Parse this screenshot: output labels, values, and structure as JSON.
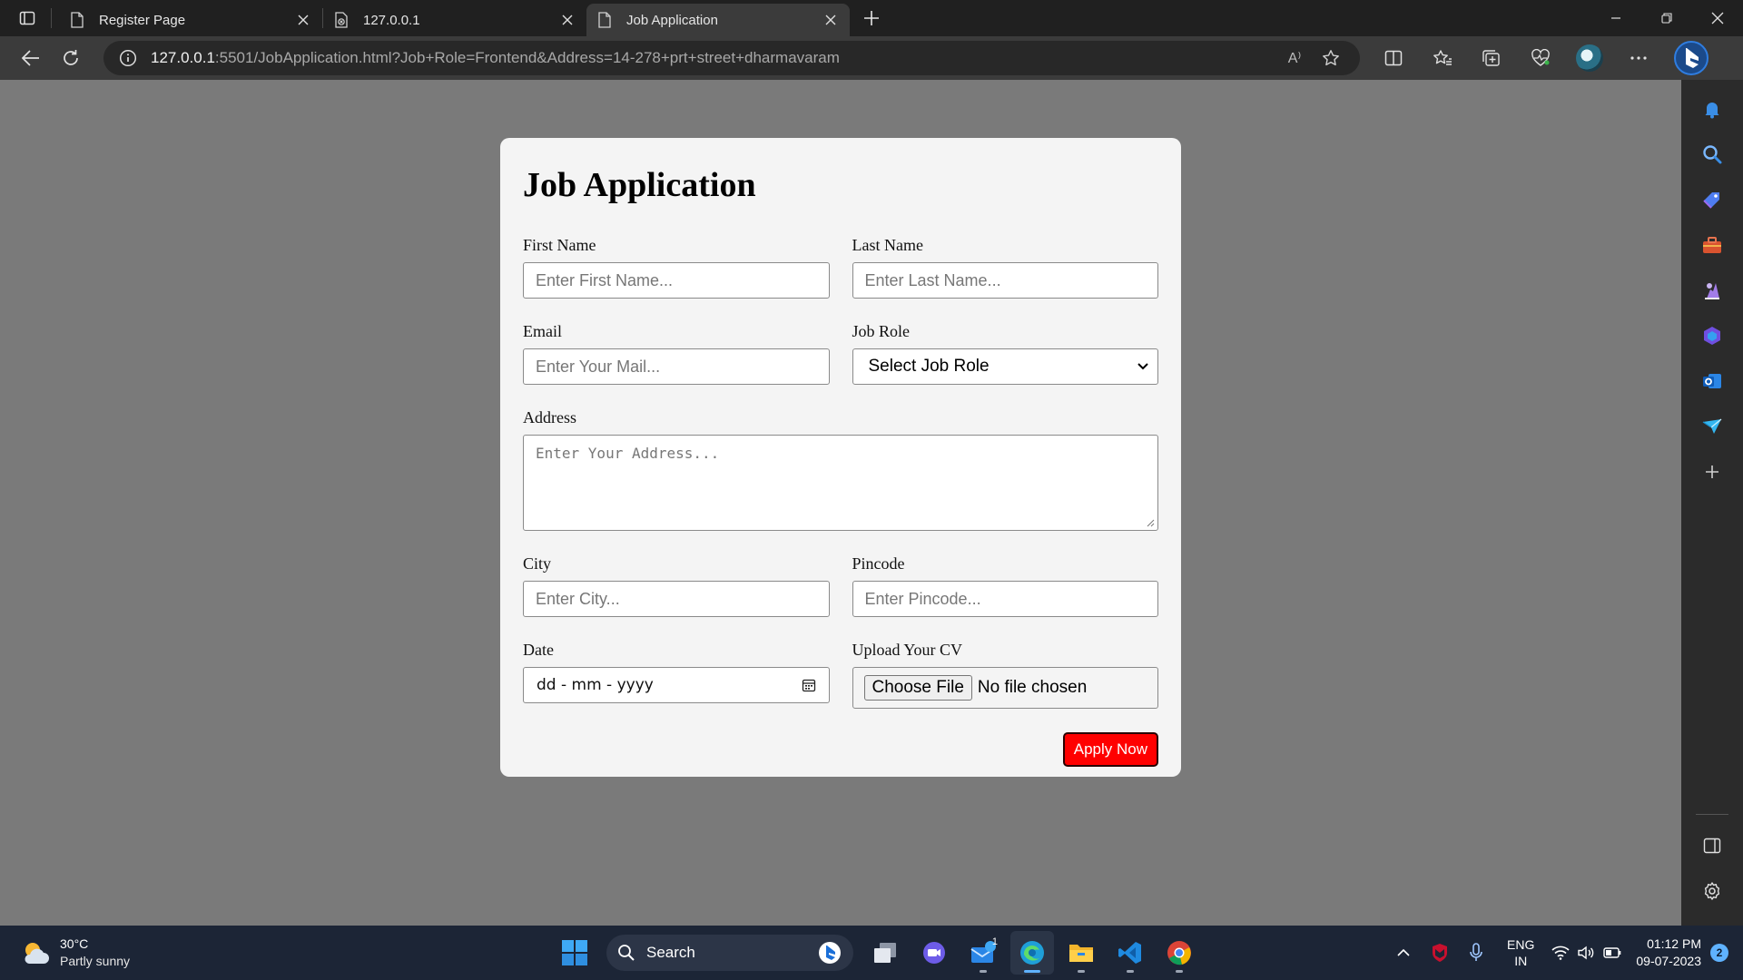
{
  "browser": {
    "tabs": [
      {
        "title": "Register Page"
      },
      {
        "title": "127.0.0.1"
      },
      {
        "title": "Job Application"
      }
    ],
    "url_host": "127.0.0.1",
    "url_rest": ":5501/JobApplication.html?Job+Role=Frontend&Address=14-278+prt+street+dharmavaram",
    "read_aloud_label": "A⁾"
  },
  "form": {
    "title": "Job Application",
    "first_name": {
      "label": "First Name",
      "placeholder": "Enter First Name..."
    },
    "last_name": {
      "label": "Last Name",
      "placeholder": "Enter Last Name..."
    },
    "email": {
      "label": "Email",
      "placeholder": "Enter Your Mail..."
    },
    "job_role": {
      "label": "Job Role",
      "selected": "Select Job Role"
    },
    "address": {
      "label": "Address",
      "placeholder": "Enter Your Address..."
    },
    "city": {
      "label": "City",
      "placeholder": "Enter City..."
    },
    "pincode": {
      "label": "Pincode",
      "placeholder": "Enter Pincode..."
    },
    "date": {
      "label": "Date",
      "value": "dd - mm - yyyy"
    },
    "cv": {
      "label": "Upload Your CV",
      "button": "Choose File",
      "status": "No file chosen"
    },
    "submit": "Apply Now"
  },
  "taskbar": {
    "weather_temp": "30°C",
    "weather_desc": "Partly sunny",
    "search_label": "Search",
    "mail_badge": "1",
    "lang_top": "ENG",
    "lang_bottom": "IN",
    "time": "01:12 PM",
    "date": "09-07-2023",
    "notification_count": "2"
  },
  "colors": {
    "page_bg": "#7a7a7a",
    "card_bg": "#f4f4f4",
    "apply_button": "#ff0000",
    "taskbar_bg": "#1c2536"
  }
}
